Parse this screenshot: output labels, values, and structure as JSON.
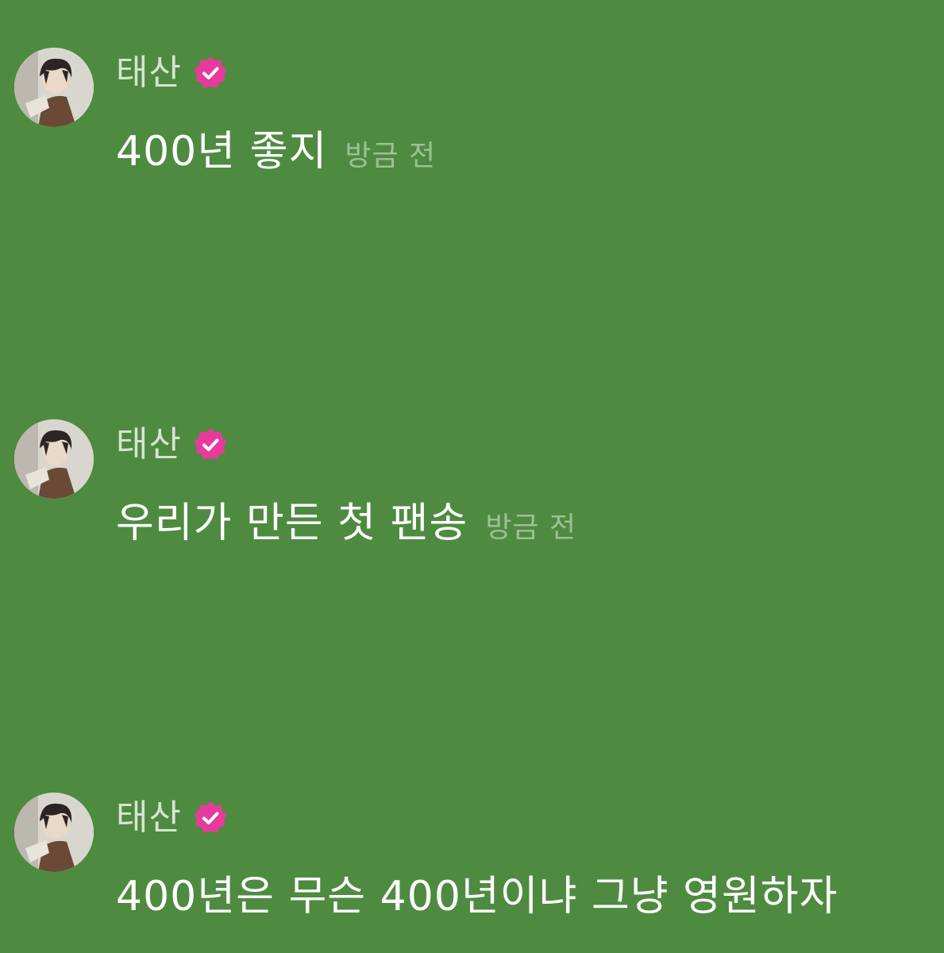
{
  "messages": [
    {
      "username": "태산",
      "verified_icon": "verified-badge-icon",
      "text": "400년 좋지",
      "timestamp": "방금 전"
    },
    {
      "username": "태산",
      "verified_icon": "verified-badge-icon",
      "text": "우리가 만든 첫 팬송",
      "timestamp": "방금 전"
    },
    {
      "username": "태산",
      "verified_icon": "verified-badge-icon",
      "text": "400년은 무슨 400년이냐 그냥 영원하자",
      "timestamp": ""
    }
  ],
  "colors": {
    "background": "#4e8b40",
    "badge": "#e83a9e",
    "text": "#ffffff",
    "username": "#d7e4d2",
    "timestamp": "#9fbf95"
  }
}
